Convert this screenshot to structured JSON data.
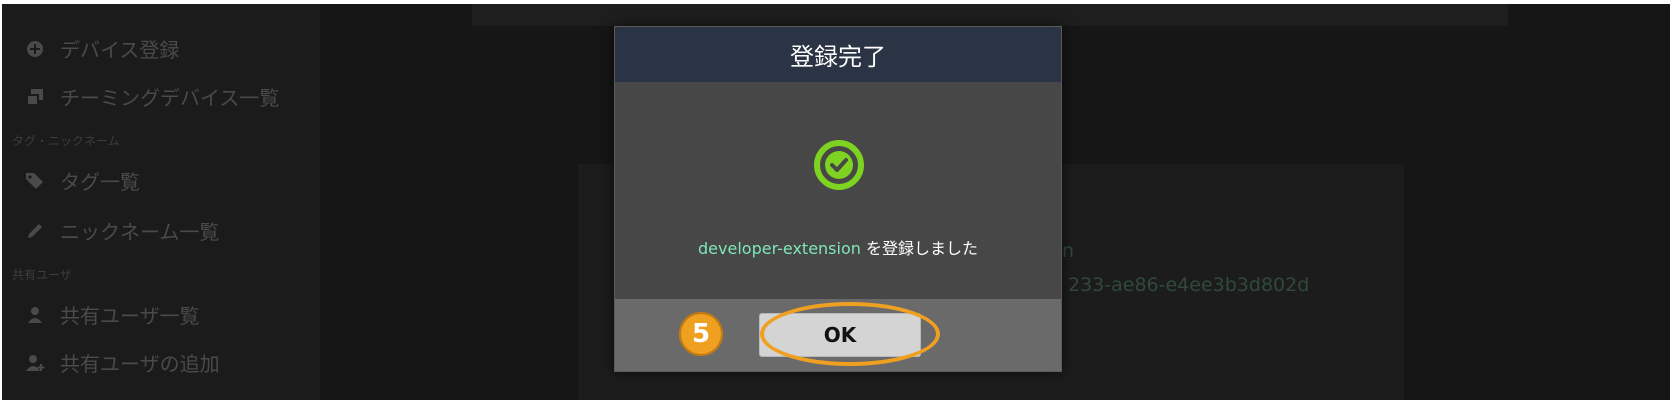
{
  "sidebar": {
    "items": [
      {
        "label": "デバイス登録",
        "icon": "plus-circle-icon"
      },
      {
        "label": "チーミングデバイス一覧",
        "icon": "clone-icon"
      },
      {
        "label": "タグ一覧",
        "icon": "tags-icon"
      },
      {
        "label": "ニックネーム一覧",
        "icon": "pencil-icon"
      },
      {
        "label": "共有ユーザ一覧",
        "icon": "user-icon"
      },
      {
        "label": "共有ユーザの追加",
        "icon": "user-plus-icon"
      }
    ],
    "sections": [
      {
        "label": "タグ・ニックネーム"
      },
      {
        "label": "共有ユーザ"
      }
    ]
  },
  "background": {
    "partial_name": "n",
    "partial_uuid": "233-ae86-e4ee3b3d802d"
  },
  "dialog": {
    "title": "登録完了",
    "icon": "check-circle-icon",
    "device_name": "developer-extension",
    "message_suffix": " を登録しました",
    "ok_label": "OK"
  },
  "annotation": {
    "step_number": "5",
    "highlight_color": "#f0a020"
  },
  "colors": {
    "header_bg": "#2a3444",
    "success_green": "#7ed321",
    "device_name": "#7ee8b8"
  }
}
